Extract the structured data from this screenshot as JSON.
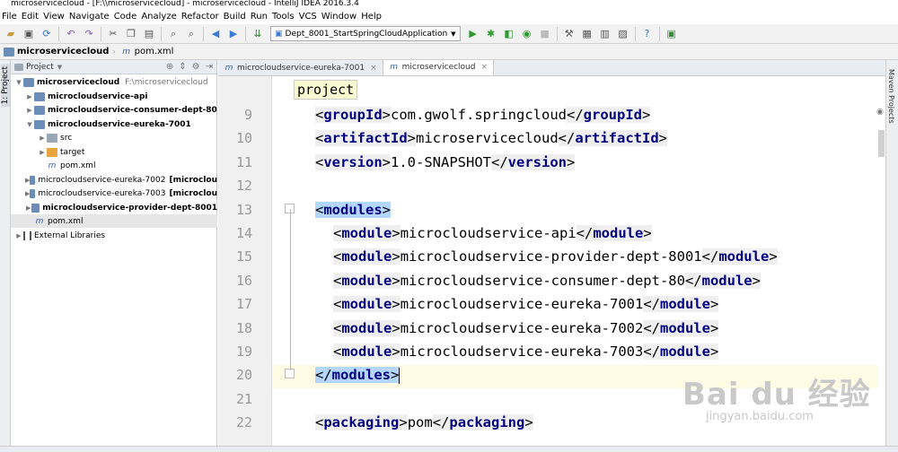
{
  "window": {
    "title": "microservicecloud - [F:\\\\microservicecloud] - microservicecloud - IntelliJ IDEA 2016.3.4"
  },
  "menu": [
    "File",
    "Edit",
    "View",
    "Navigate",
    "Code",
    "Analyze",
    "Refactor",
    "Build",
    "Run",
    "Tools",
    "VCS",
    "Window",
    "Help"
  ],
  "toolbar": {
    "run_config": "Dept_8001_StartSpringCloudApplication"
  },
  "navbar": {
    "project": "microservicecloud",
    "file": "pom.xml"
  },
  "left_tool": {
    "label": "1: Project"
  },
  "project_panel": {
    "title": "Project",
    "tree": [
      {
        "label": "microservicecloud",
        "path": "F:\\microservicecloud"
      },
      {
        "label": "microcloudservice-api"
      },
      {
        "label": "microcloudservice-consumer-dept-80"
      },
      {
        "label": "microcloudservice-eureka-7001"
      },
      {
        "label": "src"
      },
      {
        "label": "target"
      },
      {
        "label": "pom.xml"
      },
      {
        "label": "microcloudservice-eureka-7002",
        "suffix": "[microclou"
      },
      {
        "label": "microcloudservice-eureka-7003",
        "suffix": "[microclou"
      },
      {
        "label": "microcloudservice-provider-dept-8001"
      },
      {
        "label": "pom.xml"
      },
      {
        "label": "External Libraries"
      }
    ]
  },
  "tabs": [
    {
      "label": "microcloudservice-eureka-7001"
    },
    {
      "label": "microservicecloud"
    }
  ],
  "editor": {
    "popup": "project",
    "lines": [
      {
        "n": "9",
        "tag": "groupId",
        "text": "com.gwolf.springcloud"
      },
      {
        "n": "10",
        "tag": "artifactId",
        "text": "microservicecloud"
      },
      {
        "n": "11",
        "tag": "version",
        "text": "1.0-SNAPSHOT"
      },
      {
        "n": "12"
      },
      {
        "n": "13",
        "open": "modules"
      },
      {
        "n": "14",
        "tag": "module",
        "text": "microcloudservice-api"
      },
      {
        "n": "15",
        "tag": "module",
        "text": "microcloudservice-provider-dept-8001"
      },
      {
        "n": "16",
        "tag": "module",
        "text": "microcloudservice-consumer-dept-80"
      },
      {
        "n": "17",
        "tag": "module",
        "text": "microcloudservice-eureka-7001"
      },
      {
        "n": "18",
        "tag": "module",
        "text": "microcloudservice-eureka-7002"
      },
      {
        "n": "19",
        "tag": "module",
        "text": "microcloudservice-eureka-7003"
      },
      {
        "n": "20",
        "close": "modules"
      },
      {
        "n": "21"
      },
      {
        "n": "22",
        "tag": "packaging",
        "text": "pom"
      }
    ]
  },
  "right_tool": {
    "label": "Maven Projects"
  },
  "watermark": {
    "line1": "Bai du 经验",
    "line2": "jingyan.baidu.com"
  }
}
